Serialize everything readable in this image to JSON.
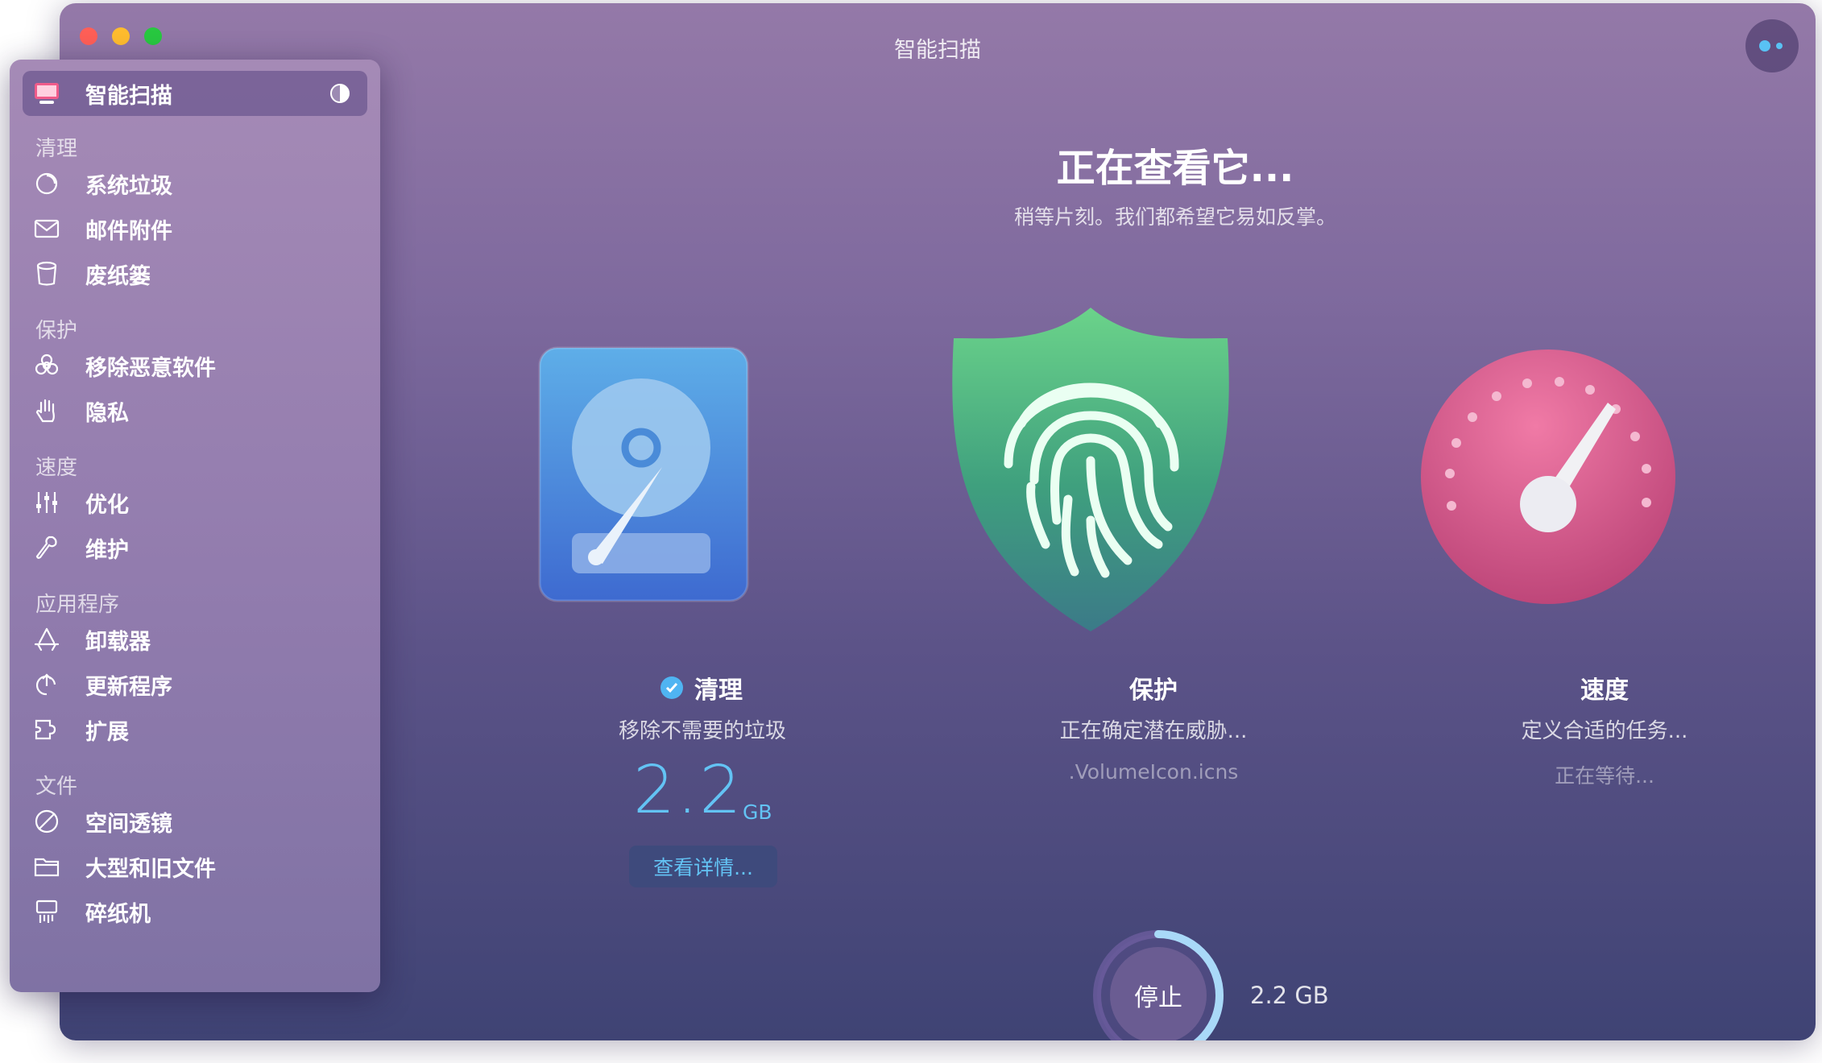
{
  "window": {
    "title": "智能扫描"
  },
  "sidebar": {
    "active_item": {
      "label": "智能扫描",
      "icon": "smart-scan-icon"
    },
    "sections": [
      {
        "label": "清理",
        "items": [
          {
            "label": "系统垃圾",
            "icon": "system-junk-icon"
          },
          {
            "label": "邮件附件",
            "icon": "mail-icon"
          },
          {
            "label": "废纸篓",
            "icon": "trash-icon"
          }
        ]
      },
      {
        "label": "保护",
        "items": [
          {
            "label": "移除恶意软件",
            "icon": "biohazard-icon"
          },
          {
            "label": "隐私",
            "icon": "hand-icon"
          }
        ]
      },
      {
        "label": "速度",
        "items": [
          {
            "label": "优化",
            "icon": "sliders-icon"
          },
          {
            "label": "维护",
            "icon": "wrench-icon"
          }
        ]
      },
      {
        "label": "应用程序",
        "items": [
          {
            "label": "卸载器",
            "icon": "uninstaller-icon"
          },
          {
            "label": "更新程序",
            "icon": "updater-icon"
          },
          {
            "label": "扩展",
            "icon": "extensions-icon"
          }
        ]
      },
      {
        "label": "文件",
        "items": [
          {
            "label": "空间透镜",
            "icon": "space-lens-icon"
          },
          {
            "label": "大型和旧文件",
            "icon": "folder-icon"
          },
          {
            "label": "碎纸机",
            "icon": "shredder-icon"
          }
        ]
      }
    ]
  },
  "main": {
    "title": "正在查看它...",
    "subtitle": "稍等片刻。我们都希望它易如反掌。"
  },
  "modules": {
    "cleanup": {
      "title": "清理",
      "description": "移除不需要的垃圾",
      "size_value": "2.2",
      "size_unit": "GB",
      "details_label": "查看详情...",
      "icon": "hard-drive-icon",
      "completed": true
    },
    "protection": {
      "title": "保护",
      "description": "正在确定潜在威胁...",
      "status": ".VolumeIcon.icns",
      "icon": "fingerprint-shield-icon"
    },
    "speed": {
      "title": "速度",
      "description": "定义合适的任务...",
      "status": "正在等待...",
      "icon": "speedometer-icon"
    }
  },
  "footer": {
    "stop_label": "停止",
    "total_size": "2.2 GB",
    "progress_fraction": 0.42
  },
  "colors": {
    "accent_blue": "#63c3f4",
    "protect_green": "#5cc27c",
    "speed_pink": "#e05a8e"
  }
}
